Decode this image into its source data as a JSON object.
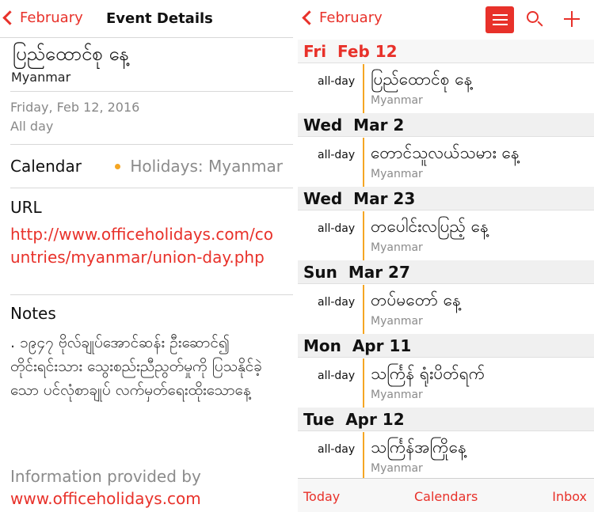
{
  "left": {
    "back_label": "February",
    "nav_title": "Event Details",
    "event_title": "ပြည်ထောင်စု နေ့",
    "event_location": "Myanmar",
    "date": "Friday, Feb 12, 2016",
    "all_day": "All day",
    "calendar_label": "Calendar",
    "calendar_value": "Holidays: Myanmar",
    "calendar_dot_color": "#f5a623",
    "url_label": "URL",
    "url_value": "http://www.officeholidays.com/countries/myanmar/union-day.php",
    "notes_label": "Notes",
    "notes_value": ". ၁၉၄၇ ဗိုလ်ချုပ်အောင်ဆန်း ဦးဆောင်၍ တိုင်းရင်းသား သွေးစည်းညီညွတ်မှုကို ပြသနိုင်ခဲ့ သော ပင်လုံစာချုပ် လက်မှတ်ရေးထိုးသောနေ့",
    "info_text": "Information provided by",
    "info_link": "www.officeholidays.com"
  },
  "right": {
    "back_label": "February",
    "icons": [
      "list-icon",
      "search-icon",
      "plus-icon"
    ],
    "accent_color": "#e8312a",
    "days": [
      {
        "header_dow": "Fri",
        "header_date": "Feb 12",
        "is_today": true,
        "allday": "all-day",
        "title": "ပြည်ထောင်စု နေ့",
        "calendar": "Myanmar"
      },
      {
        "header_dow": "Wed",
        "header_date": "Mar 2",
        "is_today": false,
        "allday": "all-day",
        "title": "တောင်သူလယ်သမား နေ့",
        "calendar": "Myanmar"
      },
      {
        "header_dow": "Wed",
        "header_date": "Mar 23",
        "is_today": false,
        "allday": "all-day",
        "title": "တပေါင်းလပြည့် နေ့",
        "calendar": "Myanmar"
      },
      {
        "header_dow": "Sun",
        "header_date": "Mar 27",
        "is_today": false,
        "allday": "all-day",
        "title": "တပ်မတော် နေ့",
        "calendar": "Myanmar"
      },
      {
        "header_dow": "Mon",
        "header_date": "Apr 11",
        "is_today": false,
        "allday": "all-day",
        "title": "သင်္ကြန် ရုံးပိတ်ရက်",
        "calendar": "Myanmar"
      },
      {
        "header_dow": "Tue",
        "header_date": "Apr 12",
        "is_today": false,
        "allday": "all-day",
        "title": "သင်္ကြန်အကြိုနေ့",
        "calendar": "Myanmar"
      }
    ],
    "tabs": {
      "today": "Today",
      "calendars": "Calendars",
      "inbox": "Inbox"
    }
  }
}
